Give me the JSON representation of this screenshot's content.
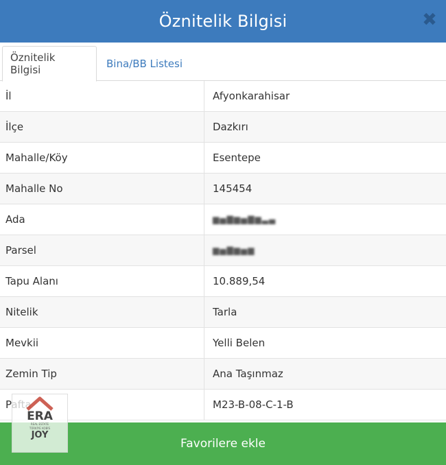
{
  "header": {
    "title": "Öznitelik Bilgisi",
    "close_icon": "✖"
  },
  "tabs": [
    {
      "label": "Öznitelik Bilgisi",
      "active": true
    },
    {
      "label": "Bina/BB Listesi",
      "active": false
    }
  ],
  "rows": [
    {
      "label": "İl",
      "value": "Afyonkarahisar"
    },
    {
      "label": "İlçe",
      "value": "Dazkırı"
    },
    {
      "label": "Mahalle/Köy",
      "value": "Esentepe"
    },
    {
      "label": "Mahalle No",
      "value": "145454"
    },
    {
      "label": "Ada",
      "value": ""
    },
    {
      "label": "Parsel",
      "value": ""
    },
    {
      "label": "Tapu Alanı",
      "value": "10.889,54"
    },
    {
      "label": "Nitelik",
      "value": "Tarla"
    },
    {
      "label": "Mevkii",
      "value": "Yelli Belen"
    },
    {
      "label": "Zemin Tip",
      "value": "Ana Taşınmaz"
    },
    {
      "label": "Pafta",
      "value": "M23-B-08-C-1-B"
    }
  ],
  "footer": {
    "button_label": "Favorilere ekle"
  },
  "watermark": {
    "brand": "ERA",
    "tagline": "REAL ESTATE",
    "sub": "TÜRKİYE KOBİS",
    "office": "JOY"
  },
  "colors": {
    "header": "#3d7bbd",
    "button": "#4caf50",
    "tab_link": "#3d7bbd"
  }
}
